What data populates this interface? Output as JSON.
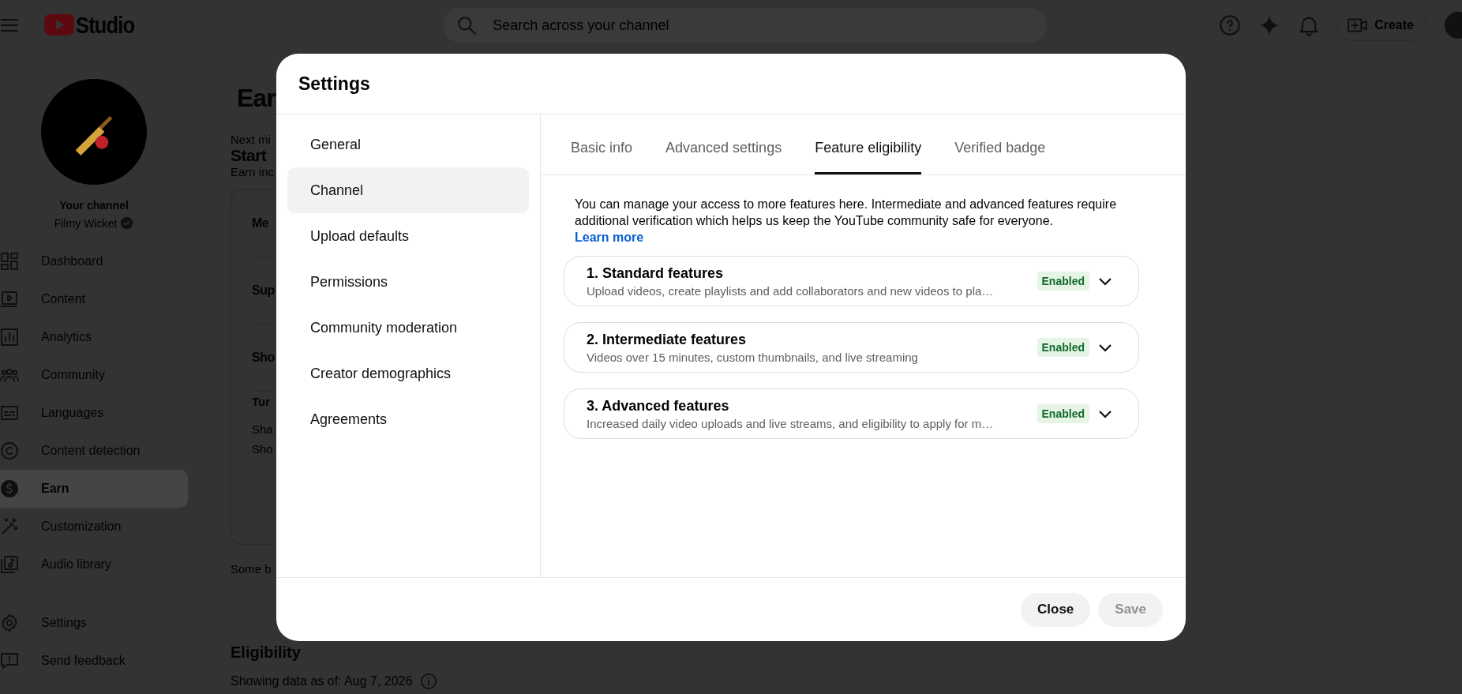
{
  "header": {
    "logo_text": "Studio",
    "search": {
      "placeholder": "Search across your channel"
    },
    "create_button": "Create"
  },
  "sidebar": {
    "channel_label": "Your channel",
    "channel_name": "Filmy Wicket",
    "items": [
      {
        "label": "Dashboard",
        "selected": false
      },
      {
        "label": "Content",
        "selected": false
      },
      {
        "label": "Analytics",
        "selected": false
      },
      {
        "label": "Community",
        "selected": false
      },
      {
        "label": "Languages",
        "selected": false
      },
      {
        "label": "Content detection",
        "selected": false
      },
      {
        "label": "Earn",
        "selected": true
      },
      {
        "label": "Customization",
        "selected": false
      },
      {
        "label": "Audio library",
        "selected": false
      }
    ],
    "footer_items": [
      {
        "label": "Settings"
      },
      {
        "label": "Send feedback"
      }
    ]
  },
  "page": {
    "title": "Ear",
    "milestone_label": "Next mi",
    "milestone_title": "Start",
    "milestone_text": "Earn inc",
    "card_rows": [
      "Me",
      "Sup",
      "Sho"
    ],
    "card_subtitle": "Tur",
    "card_lines": [
      "Sha",
      "Sho"
    ],
    "note": "Some b",
    "eligibility_title": "Eligibility",
    "eligibility_date": "Showing data as of: Aug 7, 2026"
  },
  "dialog": {
    "title": "Settings",
    "nav": [
      {
        "label": "General",
        "selected": false
      },
      {
        "label": "Channel",
        "selected": true
      },
      {
        "label": "Upload defaults",
        "selected": false
      },
      {
        "label": "Permissions",
        "selected": false
      },
      {
        "label": "Community moderation",
        "selected": false
      },
      {
        "label": "Creator demographics",
        "selected": false
      },
      {
        "label": "Agreements",
        "selected": false
      }
    ],
    "tabs": [
      {
        "label": "Basic info",
        "selected": false
      },
      {
        "label": "Advanced settings",
        "selected": false
      },
      {
        "label": "Feature eligibility",
        "selected": true
      },
      {
        "label": "Verified badge",
        "selected": false
      }
    ],
    "description": "You can manage your access to more features here. Intermediate and advanced features require additional verification which helps us keep the YouTube community safe for everyone.",
    "learn_more": "Learn more",
    "features": [
      {
        "title": "1. Standard features",
        "description": "Upload videos, create playlists and add collaborators and new videos to pla…",
        "status": "Enabled",
        "expanded": false
      },
      {
        "title": "2. Intermediate features",
        "description": "Videos over 15 minutes, custom thumbnails, and live streaming",
        "status": "Enabled",
        "expanded": false
      },
      {
        "title": "3. Advanced features",
        "description": "Increased daily video uploads and live streams, and eligibility to apply for m…",
        "status": "Enabled",
        "expanded": false
      }
    ],
    "buttons": [
      {
        "label": "Close",
        "disabled": false
      },
      {
        "label": "Save",
        "disabled": true
      }
    ]
  }
}
